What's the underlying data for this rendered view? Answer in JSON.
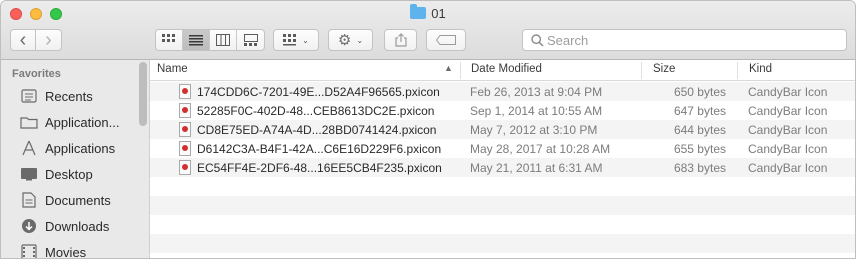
{
  "window": {
    "title": "01"
  },
  "toolbar": {
    "back_icon": "‹",
    "forward_icon": "›",
    "view_icons": [
      "▦",
      "☰",
      "▥",
      "▤"
    ],
    "group_icon": "▦",
    "gear_icon": "⚙",
    "share_icon": "⇧",
    "tag_icon": "◯",
    "chevron": "⌄"
  },
  "search": {
    "placeholder": "Search",
    "value": ""
  },
  "sidebar": {
    "heading": "Favorites",
    "items": [
      {
        "label": "Recents",
        "icon": "recents-icon",
        "glyph": "▤"
      },
      {
        "label": "Application...",
        "icon": "folder-icon",
        "glyph": "▭"
      },
      {
        "label": "Applications",
        "icon": "applications-icon",
        "glyph": "⩘"
      },
      {
        "label": "Desktop",
        "icon": "desktop-icon",
        "glyph": "▬"
      },
      {
        "label": "Documents",
        "icon": "documents-icon",
        "glyph": "▯"
      },
      {
        "label": "Downloads",
        "icon": "downloads-icon",
        "glyph": "⬇"
      },
      {
        "label": "Movies",
        "icon": "movies-icon",
        "glyph": "▥"
      }
    ]
  },
  "columns": {
    "name": "Name",
    "date": "Date Modified",
    "size": "Size",
    "kind": "Kind",
    "sort_arrow": "▲"
  },
  "files": [
    {
      "name": "174CDD6C-7201-49E...D52A4F96565.pxicon",
      "date": "Feb 26, 2013 at 9:04 PM",
      "size": "650 bytes",
      "kind": "CandyBar Icon"
    },
    {
      "name": "52285F0C-402D-48...CEB8613DC2E.pxicon",
      "date": "Sep 1, 2014 at 10:55 AM",
      "size": "647 bytes",
      "kind": "CandyBar Icon"
    },
    {
      "name": "CD8E75ED-A74A-4D...28BD0741424.pxicon",
      "date": "May 7, 2012 at 3:10 PM",
      "size": "644 bytes",
      "kind": "CandyBar Icon"
    },
    {
      "name": "D6142C3A-B4F1-42A...C6E16D229F6.pxicon",
      "date": "May 28, 2017 at 10:28 AM",
      "size": "655 bytes",
      "kind": "CandyBar Icon"
    },
    {
      "name": "EC54FF4E-2DF6-48...16EE5CB4F235.pxicon",
      "date": "May 21, 2011 at 6:31 AM",
      "size": "683 bytes",
      "kind": "CandyBar Icon"
    }
  ]
}
